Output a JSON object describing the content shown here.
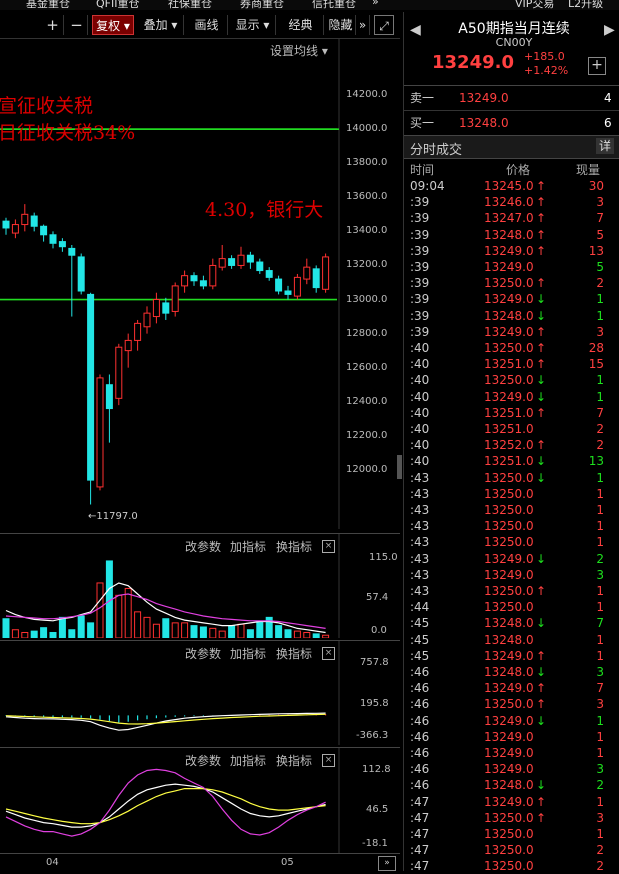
{
  "top_menu": [
    "基金重仓",
    "QFII重仓",
    "社保重仓",
    "券商重仓",
    "信托重仓",
    "»",
    "VIP交易",
    "L2升级"
  ],
  "toolbar": {
    "plus": "+",
    "minus": "−",
    "fq": "复权",
    "overlay": "叠加",
    "draw": "画线",
    "display": "显示",
    "classic": "经典",
    "hide": "隐藏",
    "more": "»",
    "expand": "⤢"
  },
  "main_chart": {
    "ma_setting": "设置均线",
    "annotations": [
      "宣征收关税",
      "日征收关税34%",
      "4.30，银行大"
    ],
    "y_labels": [
      "14200.0",
      "14000.0",
      "13800.0",
      "13600.0",
      "13400.0",
      "13200.0",
      "13000.0",
      "12800.0",
      "12600.0",
      "12400.0",
      "12200.0",
      "12000.0"
    ],
    "low_marker": "←11797.0",
    "hlines": [
      14000,
      13000
    ],
    "ylim": [
      11700,
      14400
    ],
    "candles": [
      {
        "o": 13460,
        "c": 13420,
        "h": 13480,
        "l": 13380
      },
      {
        "o": 13390,
        "c": 13440,
        "h": 13470,
        "l": 13360
      },
      {
        "o": 13440,
        "c": 13500,
        "h": 13560,
        "l": 13400
      },
      {
        "o": 13490,
        "c": 13430,
        "h": 13510,
        "l": 13400
      },
      {
        "o": 13430,
        "c": 13380,
        "h": 13440,
        "l": 13340
      },
      {
        "o": 13380,
        "c": 13330,
        "h": 13400,
        "l": 13300
      },
      {
        "o": 13340,
        "c": 13310,
        "h": 13360,
        "l": 13280
      },
      {
        "o": 13300,
        "c": 13260,
        "h": 13320,
        "l": 12900
      },
      {
        "o": 13250,
        "c": 13050,
        "h": 13270,
        "l": 13030
      },
      {
        "o": 13030,
        "c": 11940,
        "h": 13040,
        "l": 11797
      },
      {
        "o": 11900,
        "c": 12540,
        "h": 12560,
        "l": 11880
      },
      {
        "o": 12500,
        "c": 12360,
        "h": 12560,
        "l": 12160
      },
      {
        "o": 12420,
        "c": 12720,
        "h": 12740,
        "l": 12380
      },
      {
        "o": 12700,
        "c": 12760,
        "h": 12800,
        "l": 12600
      },
      {
        "o": 12760,
        "c": 12860,
        "h": 12880,
        "l": 12700
      },
      {
        "o": 12840,
        "c": 12920,
        "h": 12960,
        "l": 12800
      },
      {
        "o": 12900,
        "c": 13000,
        "h": 13040,
        "l": 12860
      },
      {
        "o": 12980,
        "c": 12920,
        "h": 13010,
        "l": 12880
      },
      {
        "o": 12930,
        "c": 13080,
        "h": 13100,
        "l": 12900
      },
      {
        "o": 13080,
        "c": 13140,
        "h": 13170,
        "l": 13040
      },
      {
        "o": 13140,
        "c": 13110,
        "h": 13160,
        "l": 13080
      },
      {
        "o": 13110,
        "c": 13080,
        "h": 13140,
        "l": 13060
      },
      {
        "o": 13080,
        "c": 13200,
        "h": 13240,
        "l": 13060
      },
      {
        "o": 13190,
        "c": 13240,
        "h": 13320,
        "l": 13170
      },
      {
        "o": 13240,
        "c": 13200,
        "h": 13260,
        "l": 13180
      },
      {
        "o": 13200,
        "c": 13260,
        "h": 13310,
        "l": 13180
      },
      {
        "o": 13260,
        "c": 13220,
        "h": 13280,
        "l": 13180
      },
      {
        "o": 13220,
        "c": 13170,
        "h": 13240,
        "l": 13150
      },
      {
        "o": 13170,
        "c": 13130,
        "h": 13190,
        "l": 13110
      },
      {
        "o": 13120,
        "c": 13050,
        "h": 13140,
        "l": 13030
      },
      {
        "o": 13050,
        "c": 13030,
        "h": 13080,
        "l": 13000
      },
      {
        "o": 13020,
        "c": 13130,
        "h": 13150,
        "l": 13000
      },
      {
        "o": 13120,
        "c": 13190,
        "h": 13240,
        "l": 13090
      },
      {
        "o": 13180,
        "c": 13070,
        "h": 13200,
        "l": 13040
      },
      {
        "o": 13060,
        "c": 13250,
        "h": 13270,
        "l": 13040
      }
    ]
  },
  "vol_panel": {
    "labels": [
      "改参数",
      "加指标",
      "换指标"
    ],
    "close": "×",
    "y_labels": [
      "115.0",
      "57.4",
      "0.0"
    ],
    "ylim": [
      0,
      125
    ],
    "bars": [
      28,
      12,
      8,
      10,
      15,
      8,
      30,
      12,
      32,
      22,
      80,
      112,
      62,
      72,
      38,
      30,
      20,
      28,
      22,
      22,
      18,
      16,
      14,
      10,
      18,
      20,
      12,
      24,
      30,
      18,
      12,
      10,
      8,
      6,
      4
    ],
    "ma1": [
      40,
      34,
      30,
      27,
      26,
      25,
      28,
      30,
      34,
      38,
      55,
      72,
      80,
      76,
      64,
      52,
      42,
      36,
      30,
      26,
      24,
      22,
      20,
      18,
      18,
      20,
      22,
      24,
      24,
      22,
      18,
      14,
      12,
      10,
      8
    ],
    "ma2": [
      32,
      31,
      30,
      29,
      28,
      28,
      29,
      31,
      33,
      36,
      44,
      54,
      62,
      64,
      60,
      56,
      50,
      46,
      42,
      38,
      35,
      32,
      30,
      28,
      27,
      26,
      25,
      25,
      25,
      24,
      22,
      20,
      18,
      16,
      14
    ]
  },
  "macd_panel": {
    "labels": [
      "改参数",
      "加指标",
      "换指标"
    ],
    "close": "×",
    "y_labels": [
      "757.8",
      "195.8",
      "-366.3"
    ],
    "ylim": [
      -420,
      800
    ],
    "bars": [
      -10,
      -14,
      -18,
      -22,
      -20,
      -22,
      -26,
      -28,
      -32,
      -40,
      -60,
      -80,
      -100,
      -90,
      -70,
      -55,
      -40,
      -30,
      -20,
      -14,
      -10,
      -8,
      -6,
      -4,
      -2,
      2,
      4,
      6,
      8,
      10,
      12,
      12,
      14,
      16,
      18
    ],
    "dif": [
      -20,
      -30,
      -40,
      -45,
      -48,
      -50,
      -55,
      -60,
      -70,
      -90,
      -140,
      -180,
      -210,
      -200,
      -170,
      -140,
      -110,
      -80,
      -60,
      -40,
      -28,
      -18,
      -10,
      -4,
      0,
      6,
      10,
      14,
      18,
      22,
      24,
      26,
      28,
      30,
      32
    ],
    "dea": [
      -5,
      -10,
      -16,
      -20,
      -25,
      -30,
      -34,
      -38,
      -44,
      -52,
      -70,
      -90,
      -110,
      -120,
      -122,
      -118,
      -110,
      -100,
      -88,
      -76,
      -65,
      -55,
      -46,
      -38,
      -30,
      -24,
      -18,
      -12,
      -8,
      -4,
      0,
      4,
      8,
      12,
      16
    ]
  },
  "kdj_panel": {
    "labels": [
      "改参数",
      "加指标",
      "换指标"
    ],
    "close": "×",
    "y_labels": [
      "112.8",
      "46.5",
      "-18.1"
    ],
    "ylim": [
      -25,
      120
    ],
    "k": [
      40,
      34,
      28,
      24,
      20,
      18,
      15,
      12,
      12,
      14,
      20,
      30,
      44,
      58,
      70,
      78,
      82,
      86,
      88,
      86,
      84,
      80,
      74,
      64,
      54,
      44,
      36,
      32,
      30,
      32,
      36,
      40,
      44,
      48,
      52
    ],
    "d": [
      44,
      40,
      36,
      32,
      28,
      25,
      22,
      20,
      18,
      18,
      20,
      25,
      32,
      40,
      50,
      58,
      66,
      72,
      76,
      80,
      80,
      80,
      78,
      74,
      68,
      62,
      54,
      48,
      44,
      42,
      42,
      44,
      46,
      48,
      50
    ],
    "j": [
      30,
      22,
      14,
      8,
      4,
      4,
      0,
      -4,
      0,
      8,
      20,
      42,
      68,
      90,
      104,
      112,
      114,
      112,
      108,
      98,
      90,
      82,
      66,
      44,
      24,
      8,
      0,
      -2,
      2,
      12,
      24,
      34,
      42,
      48,
      56
    ],
    "x_labels": [
      "04",
      "05"
    ]
  },
  "quote": {
    "title": "A50期指当月连续",
    "code": "CN00Y",
    "price": "13249.0",
    "change": "+185.0",
    "change_pct": "+1.42%",
    "add": "+",
    "sell_label": "卖一",
    "sell_price": "13249.0",
    "sell_vol": "4",
    "buy_label": "买一",
    "buy_price": "13248.0",
    "buy_vol": "6",
    "ticks_title": "分时成交",
    "detail": "详",
    "col_time": "时间",
    "col_price": "价格",
    "col_vol": "现量",
    "colors": {
      "up": "#ff4040",
      "down": "#1ee01e"
    }
  },
  "ticks": [
    {
      "t": "09:04",
      "p": "13245.0",
      "a": "up",
      "v": "30"
    },
    {
      "t": ":39",
      "p": "13246.0",
      "a": "up",
      "v": "3"
    },
    {
      "t": ":39",
      "p": "13247.0",
      "a": "up",
      "v": "7"
    },
    {
      "t": ":39",
      "p": "13248.0",
      "a": "up",
      "v": "5"
    },
    {
      "t": ":39",
      "p": "13249.0",
      "a": "up",
      "v": "13"
    },
    {
      "t": ":39",
      "p": "13249.0",
      "a": "",
      "v": "5"
    },
    {
      "t": ":39",
      "p": "13250.0",
      "a": "up",
      "v": "2"
    },
    {
      "t": ":39",
      "p": "13249.0",
      "a": "dn",
      "v": "1"
    },
    {
      "t": ":39",
      "p": "13248.0",
      "a": "dn",
      "v": "1"
    },
    {
      "t": ":39",
      "p": "13249.0",
      "a": "up",
      "v": "3"
    },
    {
      "t": ":40",
      "p": "13250.0",
      "a": "up",
      "v": "28"
    },
    {
      "t": ":40",
      "p": "13251.0",
      "a": "up",
      "v": "15"
    },
    {
      "t": ":40",
      "p": "13250.0",
      "a": "dn",
      "v": "1"
    },
    {
      "t": ":40",
      "p": "13249.0",
      "a": "dn",
      "v": "1"
    },
    {
      "t": ":40",
      "p": "13251.0",
      "a": "up",
      "v": "7"
    },
    {
      "t": ":40",
      "p": "13251.0",
      "a": "",
      "v": "2"
    },
    {
      "t": ":40",
      "p": "13252.0",
      "a": "up",
      "v": "2"
    },
    {
      "t": ":40",
      "p": "13251.0",
      "a": "dn",
      "v": "13"
    },
    {
      "t": ":43",
      "p": "13250.0",
      "a": "dn",
      "v": "1"
    },
    {
      "t": ":43",
      "p": "13250.0",
      "a": "",
      "v": "1"
    },
    {
      "t": ":43",
      "p": "13250.0",
      "a": "",
      "v": "1"
    },
    {
      "t": ":43",
      "p": "13250.0",
      "a": "",
      "v": "1"
    },
    {
      "t": ":43",
      "p": "13250.0",
      "a": "",
      "v": "1"
    },
    {
      "t": ":43",
      "p": "13249.0",
      "a": "dn",
      "v": "2"
    },
    {
      "t": ":43",
      "p": "13249.0",
      "a": "",
      "v": "3"
    },
    {
      "t": ":43",
      "p": "13250.0",
      "a": "up",
      "v": "1"
    },
    {
      "t": ":44",
      "p": "13250.0",
      "a": "",
      "v": "1"
    },
    {
      "t": ":45",
      "p": "13248.0",
      "a": "dn",
      "v": "7"
    },
    {
      "t": ":45",
      "p": "13248.0",
      "a": "",
      "v": "1"
    },
    {
      "t": ":45",
      "p": "13249.0",
      "a": "up",
      "v": "1"
    },
    {
      "t": ":46",
      "p": "13248.0",
      "a": "dn",
      "v": "3"
    },
    {
      "t": ":46",
      "p": "13249.0",
      "a": "up",
      "v": "7"
    },
    {
      "t": ":46",
      "p": "13250.0",
      "a": "up",
      "v": "3"
    },
    {
      "t": ":46",
      "p": "13249.0",
      "a": "dn",
      "v": "1"
    },
    {
      "t": ":46",
      "p": "13249.0",
      "a": "",
      "v": "1"
    },
    {
      "t": ":46",
      "p": "13249.0",
      "a": "",
      "v": "1"
    },
    {
      "t": ":46",
      "p": "13249.0",
      "a": "",
      "v": "3"
    },
    {
      "t": ":46",
      "p": "13248.0",
      "a": "dn",
      "v": "2"
    },
    {
      "t": ":47",
      "p": "13249.0",
      "a": "up",
      "v": "1"
    },
    {
      "t": ":47",
      "p": "13250.0",
      "a": "up",
      "v": "3"
    },
    {
      "t": ":47",
      "p": "13250.0",
      "a": "",
      "v": "1"
    },
    {
      "t": ":47",
      "p": "13250.0",
      "a": "",
      "v": "2"
    },
    {
      "t": ":47",
      "p": "13250.0",
      "a": "",
      "v": "2"
    }
  ]
}
